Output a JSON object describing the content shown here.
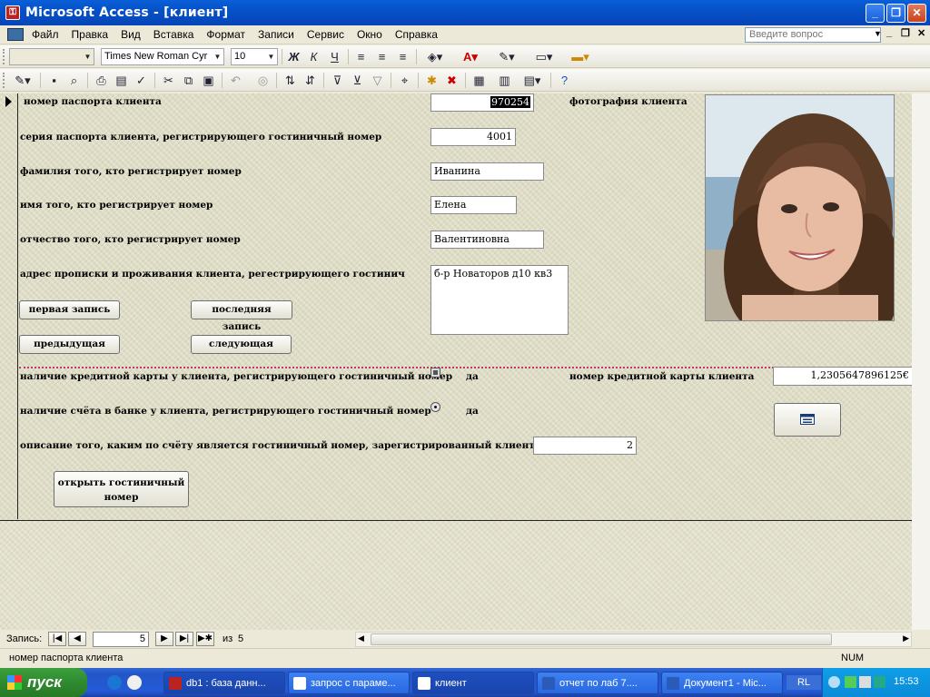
{
  "window": {
    "title": "Microsoft Access - [клиент]",
    "minimize": "_",
    "restore": "❐",
    "close": "✕"
  },
  "menu": {
    "items": [
      "Файл",
      "Правка",
      "Вид",
      "Вставка",
      "Формат",
      "Записи",
      "Сервис",
      "Окно",
      "Справка"
    ],
    "ask_placeholder": "Введите вопрос",
    "mdi_min": "_",
    "mdi_restore": "❐",
    "mdi_close": "✕"
  },
  "toolbar_format": {
    "object_combo": "",
    "font": "Times New Roman Cyr",
    "size": "10",
    "bold": "Ж",
    "italic": "К",
    "underline": "Ч"
  },
  "form": {
    "labels": {
      "passport_number": "номер паспорта клиента",
      "photo": "фотография клиента",
      "passport_series": "серия паспорта клиента, регистрирующего гостиничный номер",
      "surname": "фамилия того, кто регистрирует номер",
      "name": "имя того, кто регистрирует номер",
      "patronymic": "отчество того, кто регистрирует номер",
      "address": "адрес прописки и проживания клиента, регестрирующего гостинич",
      "has_card": "наличие кредитной карты у клиента, регистрирующего гостиничный номер",
      "card_yes": "да",
      "card_number": "номер кредитной карты клиента",
      "has_account": "наличие счёта в банке у клиента, регистрирующего гостиничный номер",
      "account_yes": "да",
      "room_description": "описание того, каким по счёту является гостиничный номер, зарегистрированный клиентом"
    },
    "values": {
      "passport_number": "970254",
      "passport_series": "4001",
      "surname": "Иванина",
      "name": "Елена",
      "patronymic": "Валентиновна",
      "address": "б-р Новаторов д10 кв3",
      "card_number": "1,2305647896125€",
      "room_description": "2"
    },
    "has_card": true,
    "has_account": true,
    "buttons": {
      "first": "первая запись",
      "last": "последняя запись",
      "prev": "предыдущая",
      "next": "следующая",
      "open_room_line1": "открыть гостиничный",
      "open_room_line2": "номер"
    }
  },
  "record_nav": {
    "label": "Запись:",
    "current": "5",
    "of_label": "из",
    "total": "5"
  },
  "status": {
    "text": "номер паспорта клиента",
    "num": "NUM"
  },
  "taskbar": {
    "start": "пуск",
    "tasks": [
      "db1 : база данн...",
      "запрос с параме...",
      "клиент",
      "отчет по лаб 7....",
      "Документ1 - Mic..."
    ],
    "lang": "RL",
    "clock": "15:53"
  },
  "colors": {
    "title_bar": "#0a5fd8",
    "form_background": "#dedcc4",
    "divider": "#c0386a",
    "taskbar": "#245ad6",
    "start": "#2f8a2f"
  }
}
